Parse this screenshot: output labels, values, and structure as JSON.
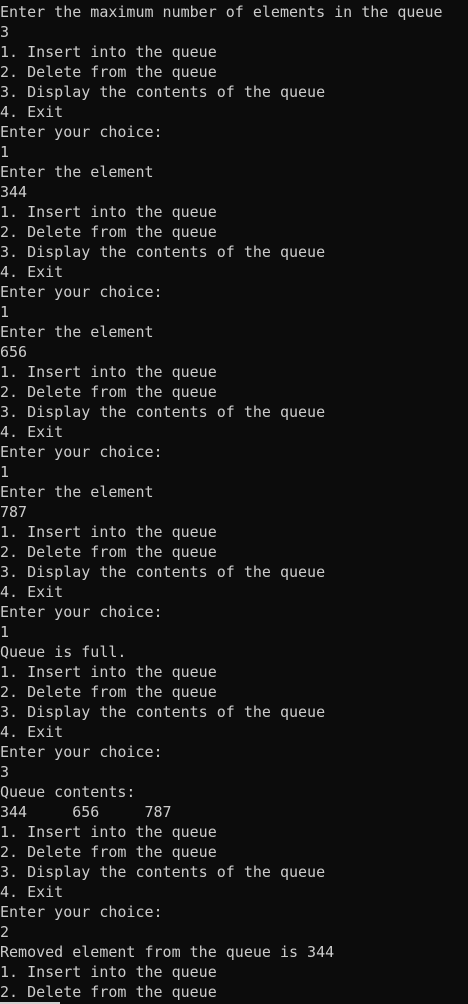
{
  "console": {
    "lines": [
      "Enter the maximum number of elements in the queue",
      "3",
      "1. Insert into the queue",
      "2. Delete from the queue",
      "3. Display the contents of the queue",
      "4. Exit",
      "Enter your choice:",
      "1",
      "Enter the element",
      "344",
      "1. Insert into the queue",
      "2. Delete from the queue",
      "3. Display the contents of the queue",
      "4. Exit",
      "Enter your choice:",
      "1",
      "Enter the element",
      "656",
      "1. Insert into the queue",
      "2. Delete from the queue",
      "3. Display the contents of the queue",
      "4. Exit",
      "Enter your choice:",
      "1",
      "Enter the element",
      "787",
      "1. Insert into the queue",
      "2. Delete from the queue",
      "3. Display the contents of the queue",
      "4. Exit",
      "Enter your choice:",
      "1",
      "Queue is full.",
      "1. Insert into the queue",
      "2. Delete from the queue",
      "3. Display the contents of the queue",
      "4. Exit",
      "Enter your choice:",
      "3",
      "Queue contents:",
      "344     656     787",
      "1. Insert into the queue",
      "2. Delete from the queue",
      "3. Display the contents of the queue",
      "4. Exit",
      "Enter your choice:",
      "2",
      "Removed element from the queue is 344",
      "1. Insert into the queue",
      "2. Delete from the queue"
    ]
  },
  "colors": {
    "background": "#0c0c0c",
    "text": "#cccccc"
  }
}
